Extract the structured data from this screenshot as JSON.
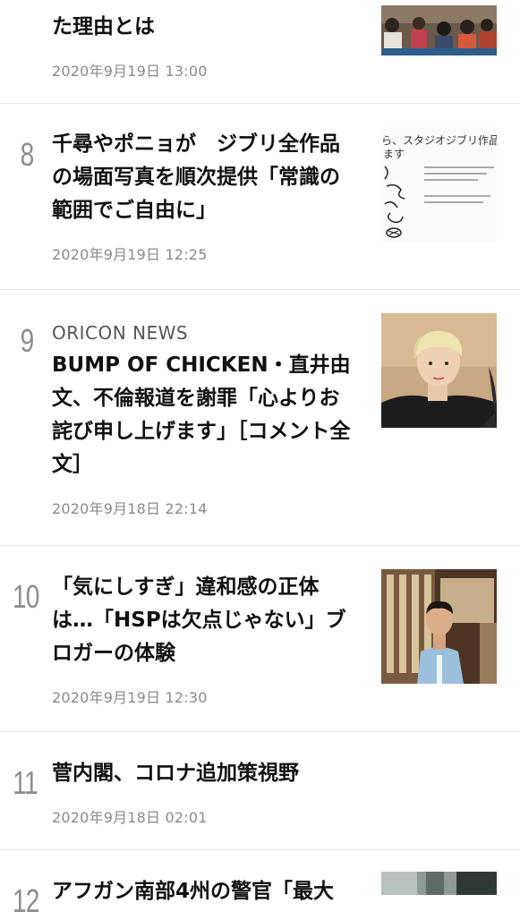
{
  "items": [
    {
      "rank": "",
      "source": "",
      "title": "た理由とは",
      "date": "2020年9月19日 13:00",
      "thumbnail_icon": "classroom-photo-icon"
    },
    {
      "rank": "8",
      "source": "",
      "title": "千尋やポニョが　ジブリ全作品の場面写真を順次提供「常識の範囲でご自由に」",
      "date": "2020年9月19日 12:25",
      "thumbnail_icon": "ghibli-notice-icon",
      "thumbnail_text_1": "ら、スタジオジブリ作品の",
      "thumbnail_text_2": "ます"
    },
    {
      "rank": "9",
      "source": "ORICON NEWS",
      "title": "BUMP OF CHICKEN・直井由文、不倫報道を謝罪「心よりお詫び申し上げます」［コメント全文］",
      "date": "2020年9月18日 22:14",
      "thumbnail_icon": "person-photo-icon"
    },
    {
      "rank": "10",
      "source": "",
      "title": "「気にしすぎ」違和感の正体は…「HSPは欠点じゃない」ブロガーの体験",
      "date": "2020年9月19日 12:30",
      "thumbnail_icon": "blogger-photo-icon"
    },
    {
      "rank": "11",
      "source": "",
      "title": "菅内閣、コロナ追加策視野",
      "date": "2020年9月18日 02:01",
      "thumbnail_icon": ""
    },
    {
      "rank": "12",
      "source": "",
      "title": "アフガン南部4州の警官「最大",
      "date": "",
      "thumbnail_icon": "street-photo-icon"
    }
  ]
}
